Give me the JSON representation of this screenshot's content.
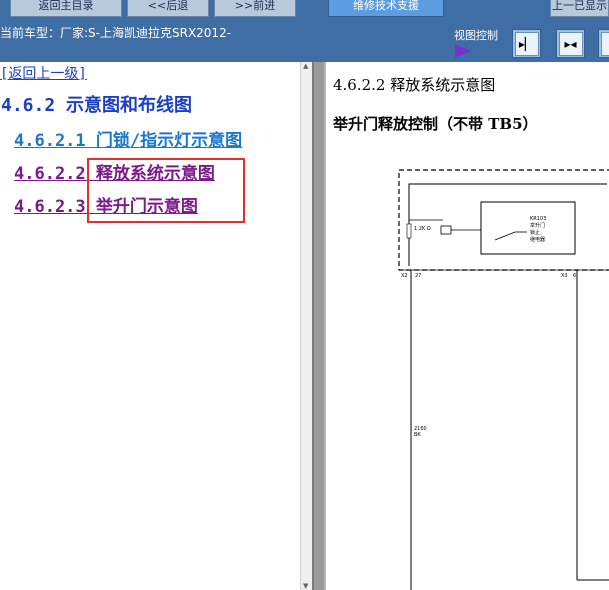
{
  "toolbar": {
    "home_label": "返回主目录",
    "back_label": "<<后退",
    "forward_label": ">>前进",
    "tech_label": "维修技术支援",
    "right_label": "上一已显示"
  },
  "header": {
    "model_text": "当前车型：厂家:S-上海凯迪拉克SRX2012-",
    "view_control_label": "视图控制"
  },
  "toc": {
    "back_link": "[返回上一级]",
    "title": "4.6.2 示意图和布线图",
    "items": [
      {
        "label": "4.6.2.1 门锁/指示灯示意图"
      },
      {
        "label": "4.6.2.2 释放系统示意图"
      },
      {
        "label": "4.6.2.3 举升门示意图"
      }
    ]
  },
  "document": {
    "heading": "4.6.2.2 释放系统示意图",
    "subtitle": "举升门释放控制（不带 TB5）",
    "diagram": {
      "resistor_label": "1.2K Ω",
      "relay_lines": [
        "KR103",
        "举升门",
        "锁止",
        "继电器"
      ],
      "connector_left": "X2",
      "pin_left": "27",
      "connector_right": "X3",
      "pin_right": "6",
      "wire_number": "2160",
      "wire_color": "BK"
    }
  },
  "colors": {
    "header_bg": "#3f6ea5",
    "accent_button": "#5b9de0",
    "highlight": "#e03030",
    "link_blue": "#1a3ec4",
    "link_visited": "#7a1a8a"
  }
}
